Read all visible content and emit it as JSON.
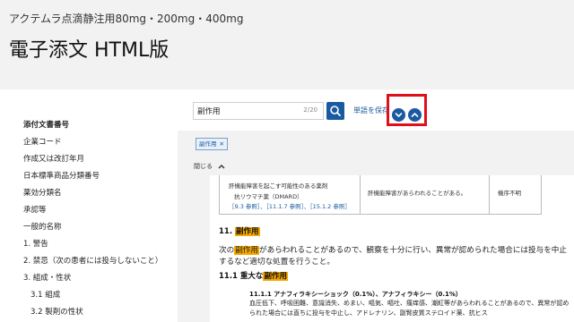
{
  "header": {
    "drug_name": "アクテムラ点滴静注用80mg・200mg・400mg",
    "page_title": "電子添文 HTML版"
  },
  "sidebar": {
    "items": [
      {
        "label": "添付文書番号",
        "bold": true
      },
      {
        "label": "企業コード"
      },
      {
        "label": "作成又は改訂年月"
      },
      {
        "label": "日本標準商品分類番号"
      },
      {
        "label": "薬効分類名"
      },
      {
        "label": "承認等"
      },
      {
        "label": "一般的名称"
      },
      {
        "label": "1. 警告"
      },
      {
        "label": "2. 禁忌（次の患者には投与しないこと）"
      },
      {
        "label": "3. 組成・性状"
      },
      {
        "label": "3.1 組成"
      },
      {
        "label": "3.2 製剤の性状"
      }
    ]
  },
  "search": {
    "value": "副作用",
    "count": "2/20",
    "save_label": "単語を保存"
  },
  "icons": {
    "search": "search-icon",
    "prev": "chevron-down-icon",
    "next": "chevron-up-icon",
    "close": "close-icon",
    "collapse": "chevron-up-icon"
  },
  "filter": {
    "chip_label": "副作用",
    "collapse_label": "閉じる"
  },
  "table": {
    "col1_line1": "肝機能障害を起こす可能性のある薬剤",
    "col1_line2": "抗リウマチ薬（DMARD）",
    "col1_refs": "［9.3 参照］、［11.1.7 参照］、［15.1.2 参照］",
    "col2": "肝機能障害があらわれることがある。",
    "col3": "機序不明"
  },
  "doc": {
    "sec11_num": "11.",
    "sec11_hl": "副作用",
    "para_hl": "副作用",
    "para_rest": "があらわれることがあるので、観察を十分に行い、異常が認められた場合には投与を中止するなど適切な処置を行うこと。",
    "para_prefix": "次の",
    "sec111_prefix": "11.1 重大な",
    "sec111_hl": "副作用",
    "sub_title": "11.1.1 アナフィラキシーショック（0.1%）、アナフィラキシー（0.1%）",
    "sub_body": "血圧低下、呼吸困難、意識消失、めまい、嘔気、嘔吐、瘙痒感、潮紅等があらわれることがあるので、異常が認められた場合には直ちに投与を中止し、アドレナリン、副腎皮質ステロイド薬、抗ヒス"
  },
  "colors": {
    "accent": "#1a5aa0",
    "highlight": "#f6a800",
    "annotation": "#e0101a",
    "page_bg": "#f2f2f2"
  }
}
